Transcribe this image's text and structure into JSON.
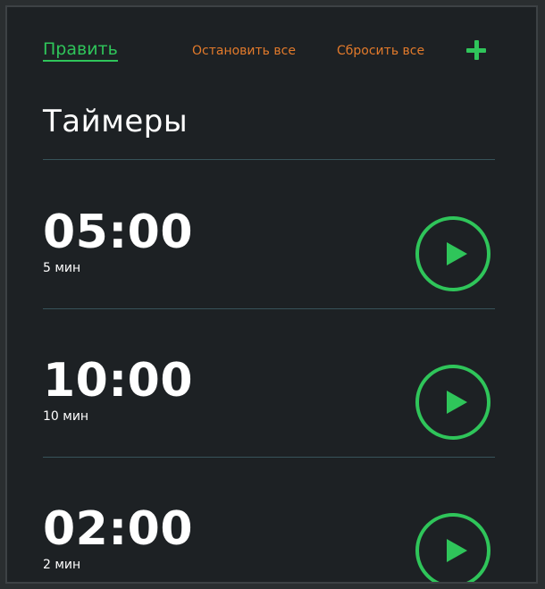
{
  "toolbar": {
    "edit_label": "Править",
    "stop_all_label": "Остановить все",
    "reset_all_label": "Сбросить все",
    "add_icon": "plus-icon"
  },
  "page": {
    "title": "Таймеры"
  },
  "timers": [
    {
      "time": "05:00",
      "label": "5 мин",
      "action_icon": "play-icon"
    },
    {
      "time": "10:00",
      "label": "10 мин",
      "action_icon": "play-icon"
    },
    {
      "time": "02:00",
      "label": "2 мин",
      "action_icon": "play-icon"
    }
  ],
  "colors": {
    "accent_green": "#2fc55a",
    "accent_orange": "#e27a2b",
    "background": "#1d2124",
    "divider": "#37535a",
    "text": "#ffffff"
  }
}
